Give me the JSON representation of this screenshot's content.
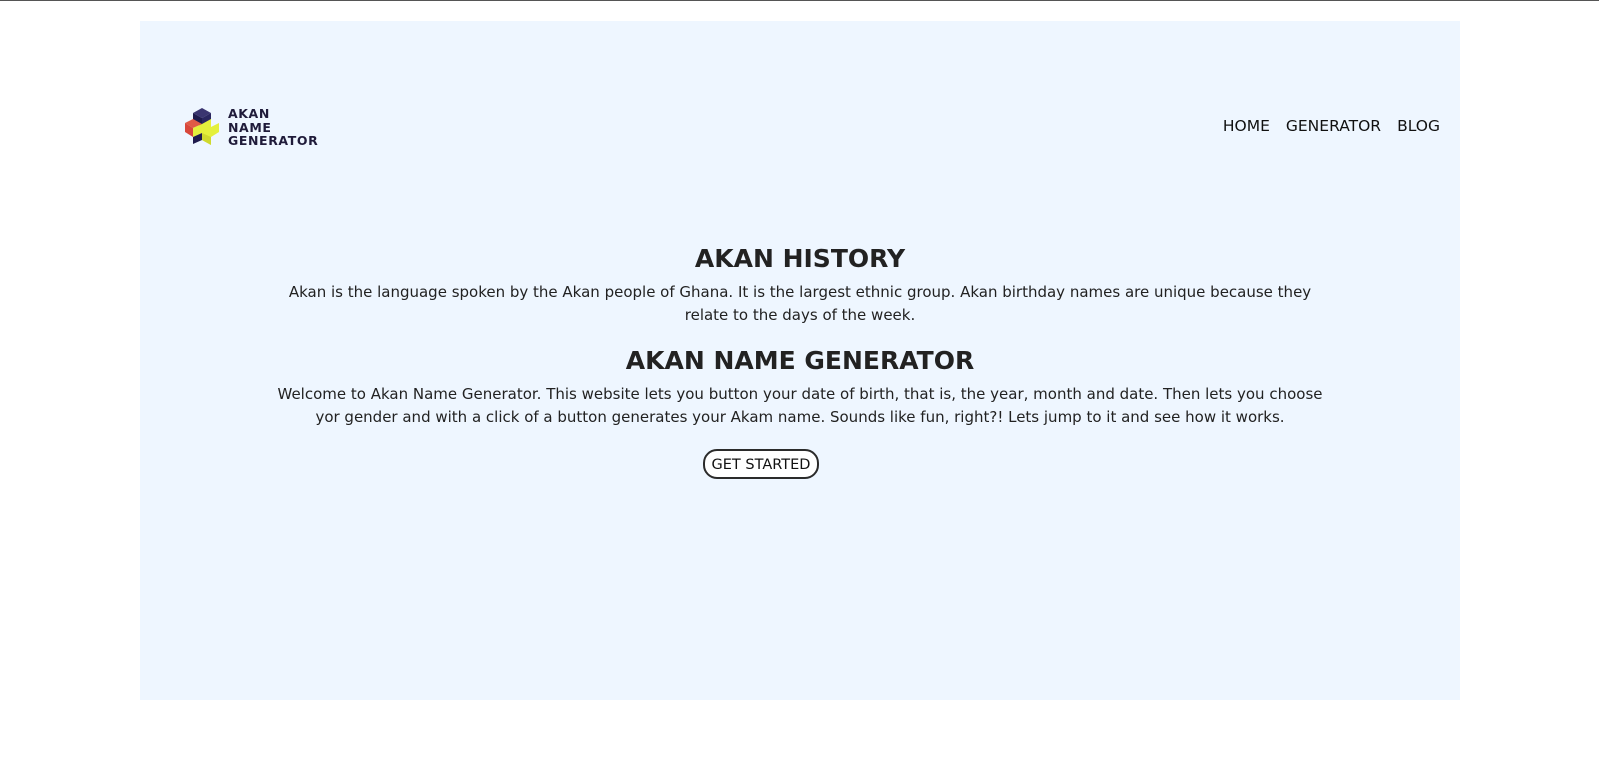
{
  "logo": {
    "icon": "cube-plus-logo-icon",
    "line1": "AKAN",
    "line2": "NAME",
    "line3": "GENERATOR"
  },
  "nav": {
    "items": [
      {
        "label": "HOME"
      },
      {
        "label": "GENERATOR"
      },
      {
        "label": "BLOG"
      }
    ]
  },
  "history": {
    "title": "AKAN HISTORY",
    "text": "Akan is the language spoken by the Akan people of Ghana. It is the largest ethnic group. Akan birthday names are unique because they relate to the days of the week."
  },
  "generator": {
    "title": "AKAN NAME GENERATOR",
    "text": "Welcome to Akan Name Generator. This website lets you button your date of birth, that is, the year, month and date. Then lets you choose yor gender and with a click of a button generates your Akam name. Sounds like fun, right?! Lets jump to it and see how it works.",
    "button_label": "GET STARTED"
  },
  "colors": {
    "panel_background": "#eef6ff",
    "logo_yellow": "#e4f03c",
    "logo_navy": "#1f1b4d",
    "logo_red": "#d8473b"
  }
}
